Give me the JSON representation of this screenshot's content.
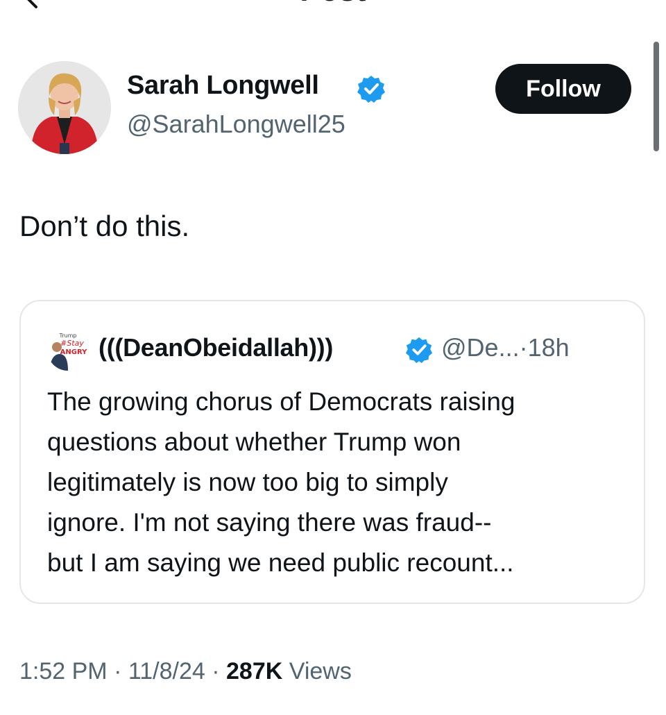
{
  "header": {
    "title": "Post",
    "back_icon": "arrow-left-icon"
  },
  "author": {
    "name": "Sarah Longwell",
    "handle": "@SarahLongwell25",
    "verified": true,
    "avatar_icon": "person-avatar"
  },
  "follow_button": {
    "label": "Follow"
  },
  "post": {
    "text": "Don’t do this."
  },
  "quoted_post": {
    "author_name": "(((DeanObeidallah)))",
    "author_handle": "@De...",
    "separator": "·",
    "age": "18h",
    "verified": true,
    "avatar_text": [
      "Trump",
      "#Stay",
      "ANGRY"
    ],
    "text_lines": [
      "The growing chorus of Democrats raising",
      "questions about whether Trump won",
      "legitimately is now too big to simply",
      "ignore. I'm not saying there was fraud--",
      "but I am saying we need public recount..."
    ]
  },
  "meta": {
    "time": "1:52 PM",
    "separator1": "·",
    "date": "11/8/24",
    "separator2": "·",
    "views_count": "287K",
    "views_label": "Views"
  },
  "colors": {
    "text": "#0f1419",
    "secondary": "#536471",
    "verified_blue": "#1d9bf0",
    "follow_bg": "#0f1419",
    "card_border": "#e3e7ea"
  }
}
